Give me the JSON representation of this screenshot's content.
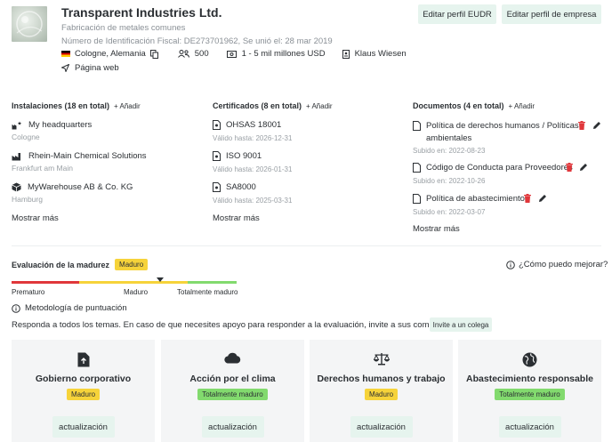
{
  "company": {
    "name": "Transparent Industries Ltd.",
    "sector": "Fabricación de metales comunes",
    "fiscal_line": "Número de Identificación Fiscal: DE273701962, Se unió el: 28 mar 2019",
    "location": "Cologne, Alemania",
    "employees": "500",
    "revenue": "1 - 5 mil millones USD",
    "contact": "Klaus Wiesen",
    "website": "Página web"
  },
  "buttons": {
    "edit_eudr": "Editar perfil EUDR",
    "edit_company": "Editar perfil de empresa"
  },
  "installations": {
    "title": "Instalaciones (18 en total)",
    "add": "+ Añadir",
    "items": [
      {
        "name": "My headquarters",
        "city": "Cologne"
      },
      {
        "name": "Rhein-Main Chemical Solutions",
        "city": "Frankfurt am Main"
      },
      {
        "name": "MyWarehouse AB & Co. KG",
        "city": "Hamburg"
      }
    ],
    "more": "Mostrar más"
  },
  "certificates": {
    "title": "Certificados (8 en total)",
    "add": "+ Añadir",
    "items": [
      {
        "name": "OHSAS 18001",
        "valid": "Válido hasta: 2026-12-31"
      },
      {
        "name": "ISO 9001",
        "valid": "Válido hasta: 2026-01-31"
      },
      {
        "name": "SA8000",
        "valid": "Válido hasta: 2025-03-31"
      }
    ],
    "more": "Mostrar más"
  },
  "documents": {
    "title": "Documentos (4 en total)",
    "add": "+ Añadir",
    "items": [
      {
        "line1": "Política de derechos humanos / Políticas",
        "line2": "ambientales",
        "uploaded": "Subido en: 2022-08-23"
      },
      {
        "line1": "Código de Conducta para Proveedores",
        "uploaded": "Subido en: 2022-10-26"
      },
      {
        "line1": "Política de abastecimiento",
        "uploaded": "Subido en: 2022-03-07"
      }
    ],
    "more": "Mostrar más"
  },
  "maturity": {
    "title": "Evaluación de la madurez",
    "badge": "Maduro",
    "help": "¿Cómo puedo mejorar?",
    "scale_labels": [
      "Prematuro",
      "Maduro",
      "Totalmente maduro"
    ],
    "level": 0.66,
    "methodology": "Metodología de puntuación",
    "instruction": "Responda a todos los temas. En caso de que necesites apoyo para responder a la evaluación, invite a sus compañeros.",
    "invite": "Invite a un colega"
  },
  "topics": [
    {
      "title": "Gobierno corporativo",
      "badge": "Maduro",
      "badge_color": "#f6d33a",
      "icon": "upload-file-icon",
      "action": "actualización"
    },
    {
      "title": "Acción por el clima",
      "badge": "Totalmente maduro",
      "badge_color": "#82da6e",
      "icon": "cloud-icon",
      "action": "actualización"
    },
    {
      "title": "Derechos humanos y trabajo",
      "badge": "Maduro",
      "badge_color": "#f6d33a",
      "icon": "scales-icon",
      "action": "actualización"
    },
    {
      "title": "Abastecimiento responsable",
      "badge": "Totalmente maduro",
      "badge_color": "#82da6e",
      "icon": "globe-icon",
      "action": "actualización"
    }
  ],
  "colors": {
    "accent_bg": "#e6f4ee",
    "bar_red": "#e0373b",
    "bar_yellow": "#f6d33a",
    "bar_green": "#82da6e",
    "delete_red": "#e0373b"
  }
}
